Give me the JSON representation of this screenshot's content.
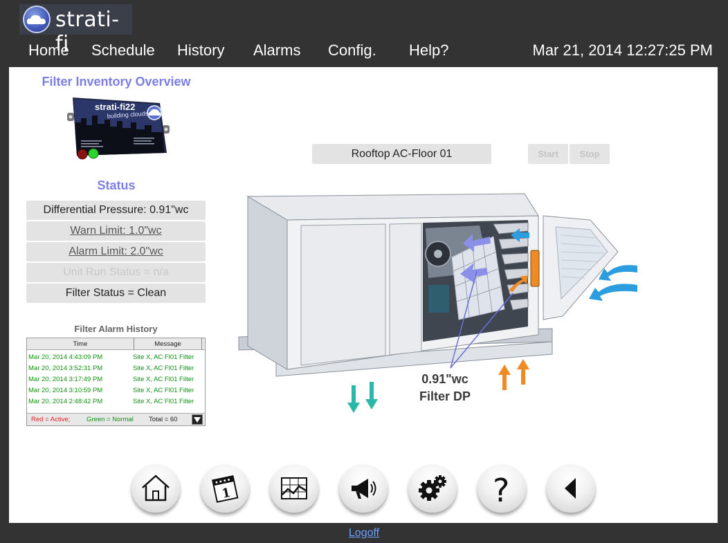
{
  "brand": {
    "name": "strati-fi",
    "logo_icon": "cloud-icon"
  },
  "nav": {
    "items": [
      {
        "label": "Home"
      },
      {
        "label": "Schedule"
      },
      {
        "label": "History"
      },
      {
        "label": "Alarms"
      },
      {
        "label": "Config."
      },
      {
        "label": "Help?"
      }
    ],
    "datetime": "Mar 21, 2014 12:27:25 PM"
  },
  "sidebar": {
    "title": "Filter Inventory Overview",
    "device": {
      "name": "strati-fi22",
      "tagline": "building clouds"
    },
    "status_title": "Status",
    "status_rows": [
      "Differential Pressure:  0.91\"wc",
      "Warn Limit: 1.0\"wc",
      "Alarm Limit: 2.0\"wc",
      "Unit Run Status = n/a",
      "Filter Status = Clean"
    ]
  },
  "alarm_history": {
    "title": "Filter Alarm History",
    "columns": [
      "Time",
      "Message"
    ],
    "rows": [
      {
        "time": "Mar 20, 2014 4:43:09 PM",
        "message": "Site X, AC Fl01 Filter"
      },
      {
        "time": "Mar 20, 2014 3:52:31 PM",
        "message": "Site X, AC Fl01 Filter"
      },
      {
        "time": "Mar 20, 2014 3:17:49 PM",
        "message": "Site X, AC Fl01 Filter"
      },
      {
        "time": "Mar 20, 2014 3:10:59 PM",
        "message": "Site X, AC Fl01 Filter"
      },
      {
        "time": "Mar 20, 2014 2:48:42 PM",
        "message": "Site X, AC Fl01 Filter"
      }
    ],
    "legend_active": "Red = Active;",
    "legend_normal": "Green = Normal",
    "total": "Total = 60",
    "colors": {
      "active": "#e02020",
      "normal": "#119011"
    }
  },
  "unit": {
    "name": "Rooftop AC-Floor 01",
    "start_label": "Start",
    "stop_label": "Stop",
    "dp_value": "0.91\"wc",
    "dp_label": "Filter DP"
  },
  "toolbar": {
    "icons": [
      "home-icon",
      "calendar-icon",
      "chart-icon",
      "megaphone-icon",
      "gear-icon",
      "help-icon",
      "back-icon"
    ]
  },
  "footer": {
    "logoff_label": "Logoff"
  },
  "colors": {
    "accent": "#7d7de8",
    "header_bg": "#333333",
    "supply_air": "#2ab8a8",
    "return_air": "#f08a24",
    "outside_air": "#2c9ee0"
  }
}
